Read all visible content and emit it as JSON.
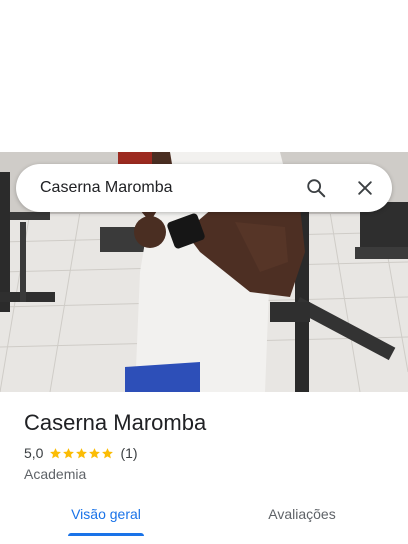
{
  "search": {
    "query": "Caserna Maromba",
    "search_icon": "search-icon",
    "close_icon": "close-icon"
  },
  "place": {
    "name": "Caserna Maromba",
    "rating": "5,0",
    "stars": 5,
    "review_count": "(1)",
    "category": "Academia"
  },
  "tabs": [
    {
      "label": "Visão geral",
      "selected": true
    },
    {
      "label": "Avaliações",
      "selected": false
    }
  ],
  "colors": {
    "accent": "#1a73e8",
    "star": "#fbbc04",
    "text_primary": "#202124",
    "text_secondary": "#5f6368"
  }
}
